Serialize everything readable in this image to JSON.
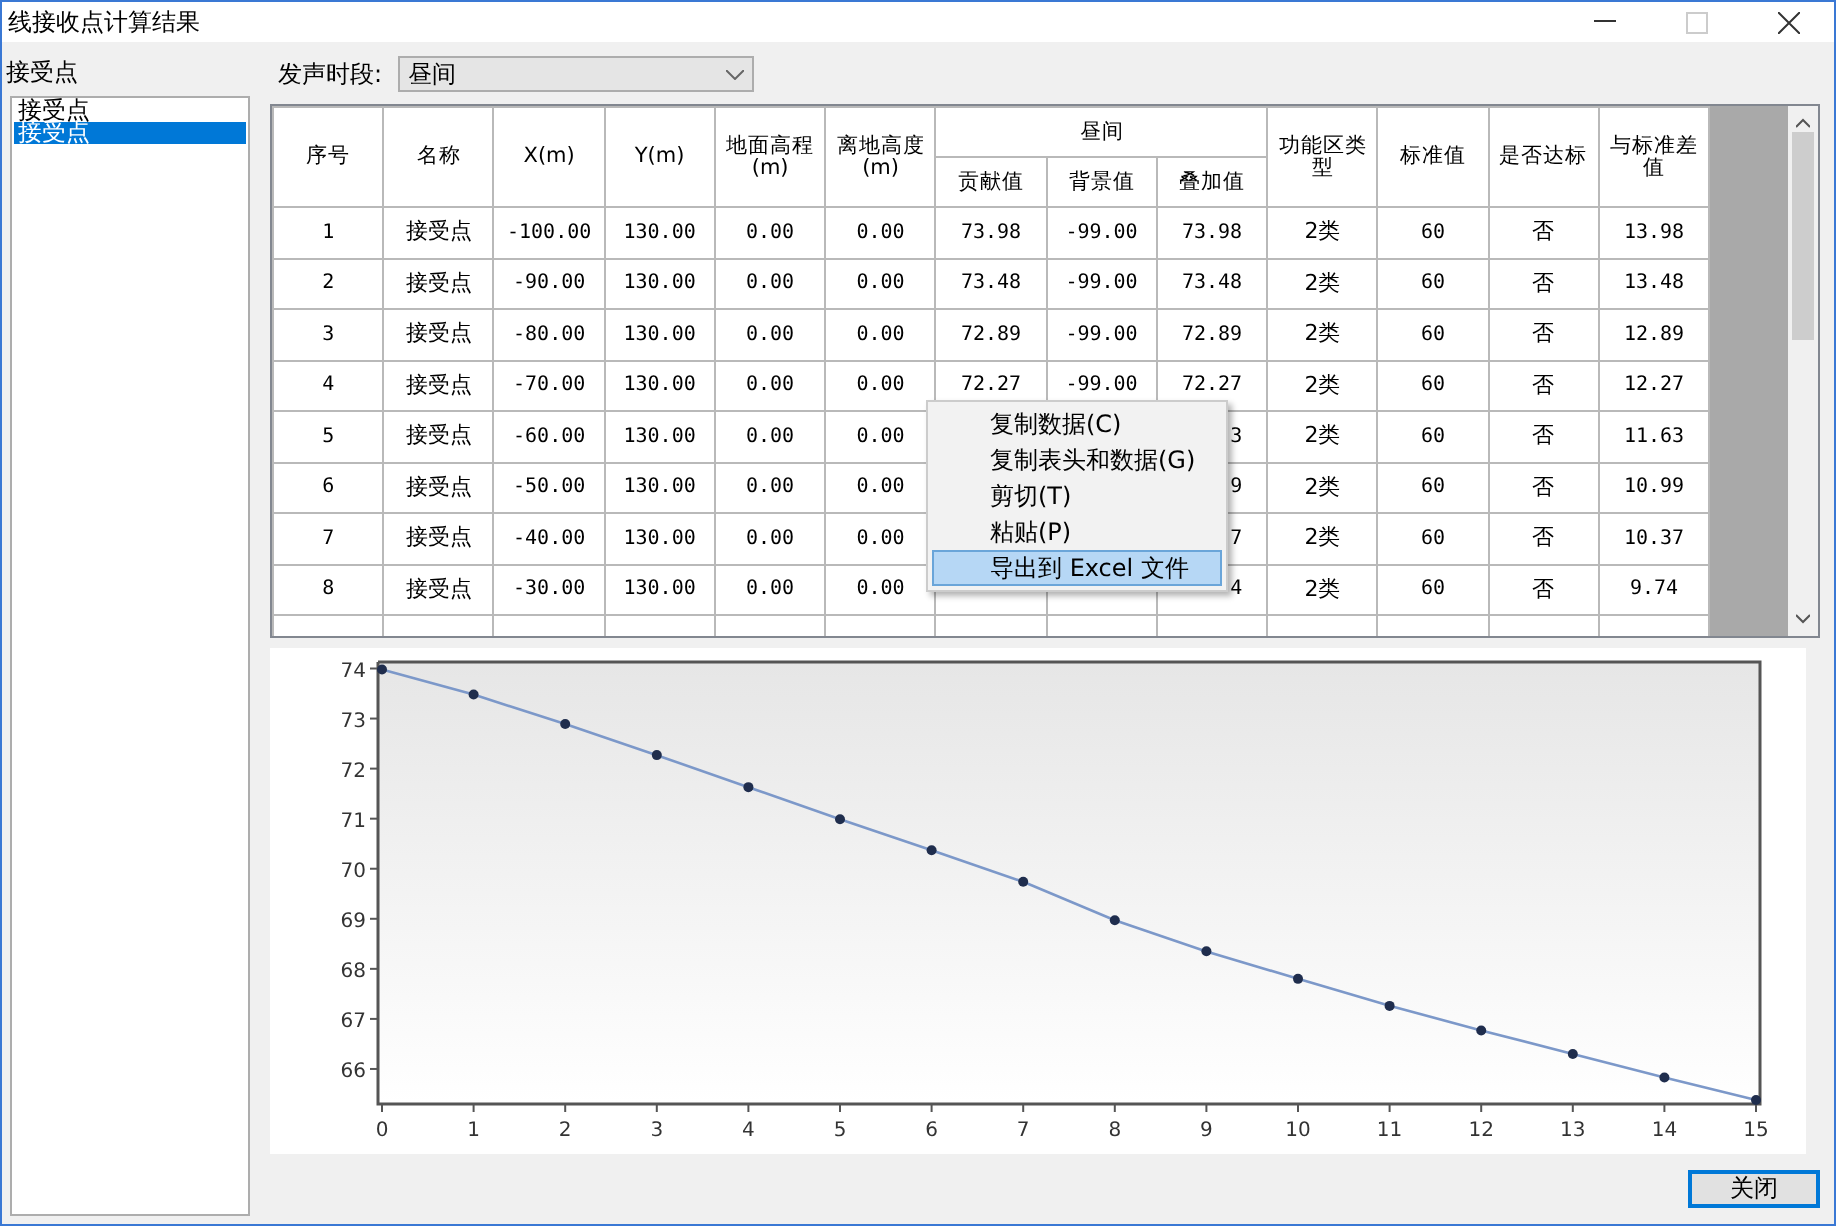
{
  "window": {
    "title": "线接收点计算结果"
  },
  "receivers": {
    "title": "接受点",
    "items": [
      {
        "label": "接受点",
        "selected": false
      },
      {
        "label": "接受点",
        "selected": true
      }
    ]
  },
  "period": {
    "label": "发声时段:",
    "value": "昼间"
  },
  "table": {
    "columns": [
      {
        "label": "序号"
      },
      {
        "label": "名称"
      },
      {
        "label": "X(m)"
      },
      {
        "label": "Y(m)"
      },
      {
        "label": "地面高程(m)"
      },
      {
        "label": "离地高度(m)"
      },
      {
        "label": "昼间",
        "colspan": 3,
        "children": [
          {
            "label": "贡献值"
          },
          {
            "label": "背景值"
          },
          {
            "label": "叠加值"
          }
        ]
      },
      {
        "label": "功能区类型"
      },
      {
        "label": "标准值"
      },
      {
        "label": "是否达标"
      },
      {
        "label": "与标准差值"
      }
    ],
    "rows": [
      [
        "1",
        "接受点",
        "-100.00",
        "130.00",
        "0.00",
        "0.00",
        "73.98",
        "-99.00",
        "73.98",
        "2类",
        "60",
        "否",
        "13.98"
      ],
      [
        "2",
        "接受点",
        "-90.00",
        "130.00",
        "0.00",
        "0.00",
        "73.48",
        "-99.00",
        "73.48",
        "2类",
        "60",
        "否",
        "13.48"
      ],
      [
        "3",
        "接受点",
        "-80.00",
        "130.00",
        "0.00",
        "0.00",
        "72.89",
        "-99.00",
        "72.89",
        "2类",
        "60",
        "否",
        "12.89"
      ],
      [
        "4",
        "接受点",
        "-70.00",
        "130.00",
        "0.00",
        "0.00",
        "72.27",
        "-99.00",
        "72.27",
        "2类",
        "60",
        "否",
        "12.27"
      ],
      [
        "5",
        "接受点",
        "-60.00",
        "130.00",
        "0.00",
        "0.00",
        null,
        null,
        "3",
        "2类",
        "60",
        "否",
        "11.63"
      ],
      [
        "6",
        "接受点",
        "-50.00",
        "130.00",
        "0.00",
        "0.00",
        null,
        null,
        "9",
        "2类",
        "60",
        "否",
        "10.99"
      ],
      [
        "7",
        "接受点",
        "-40.00",
        "130.00",
        "0.00",
        "0.00",
        null,
        null,
        "7",
        "2类",
        "60",
        "否",
        "10.37"
      ],
      [
        "8",
        "接受点",
        "-30.00",
        "130.00",
        "0.00",
        "0.00",
        null,
        null,
        "4",
        "2类",
        "60",
        "否",
        "9.74"
      ]
    ]
  },
  "context_menu": {
    "items": [
      {
        "label": "复制数据(C)",
        "selected": false
      },
      {
        "label": "复制表头和数据(G)",
        "selected": false
      },
      {
        "label": "剪切(T)",
        "selected": false
      },
      {
        "label": "粘贴(P)",
        "selected": false
      },
      {
        "label": "导出到 Excel 文件",
        "selected": true
      }
    ]
  },
  "chart": {
    "chart_data": {
      "type": "line",
      "x": [
        0,
        1,
        2,
        3,
        4,
        5,
        6,
        7,
        8,
        9,
        10,
        11,
        12,
        13,
        14,
        15
      ],
      "series": [
        {
          "color": "#7c98c9",
          "marker": "circle",
          "values": [
            73.98,
            73.48,
            72.89,
            72.27,
            71.63,
            70.99,
            70.37,
            69.74,
            68.97,
            68.35,
            67.8,
            67.26,
            66.77,
            66.3,
            65.83,
            65.38
          ]
        }
      ],
      "xlim": [
        0,
        15
      ],
      "ylim": [
        65.3,
        74.05
      ],
      "xticks": [
        0,
        1,
        2,
        3,
        4,
        5,
        6,
        7,
        8,
        9,
        10,
        11,
        12,
        13,
        14,
        15
      ],
      "yticks": [
        66,
        67,
        68,
        69,
        70,
        71,
        72,
        73,
        74
      ]
    }
  },
  "buttons": {
    "close": "关闭"
  }
}
